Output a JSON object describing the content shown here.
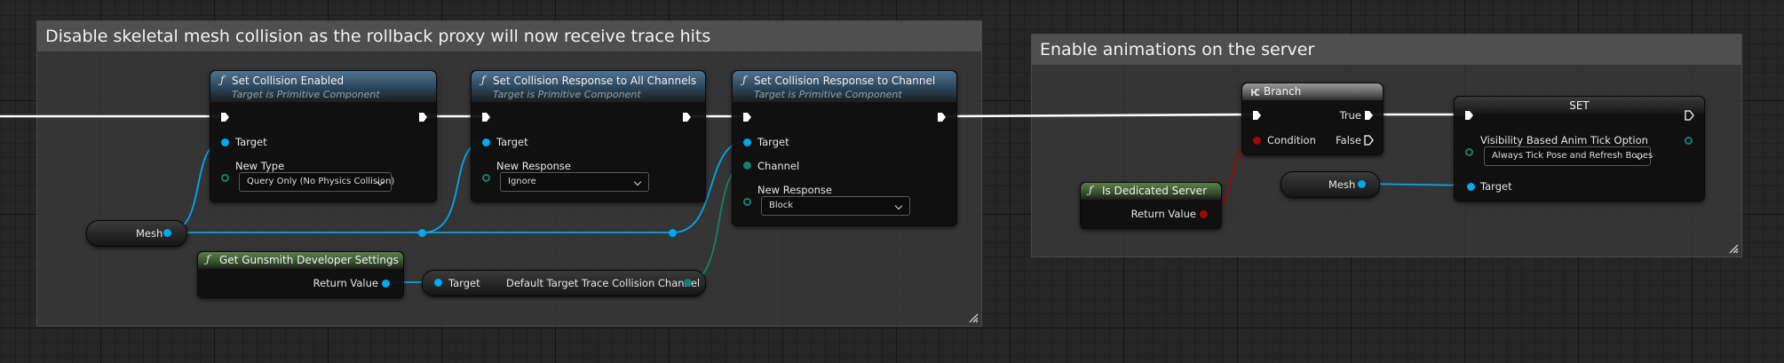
{
  "comments": [
    {
      "title": "Disable skeletal mesh collision as the rollback proxy will now receive trace hits"
    },
    {
      "title": "Enable animations on the server"
    }
  ],
  "nodes": {
    "set_collision_enabled": {
      "title": "Set Collision Enabled",
      "subtitle": "Target is Primitive Component",
      "target_label": "Target",
      "new_type_label": "New Type",
      "new_type_value": "Query Only (No Physics Collision)"
    },
    "set_response_all": {
      "title": "Set Collision Response to All Channels",
      "subtitle": "Target is Primitive Component",
      "target_label": "Target",
      "new_response_label": "New Response",
      "new_response_value": "Ignore"
    },
    "set_response_channel": {
      "title": "Set Collision Response to Channel",
      "subtitle": "Target is Primitive Component",
      "target_label": "Target",
      "channel_label": "Channel",
      "new_response_label": "New Response",
      "new_response_value": "Block"
    },
    "mesh_var_left": {
      "label": "Mesh"
    },
    "get_dev_settings": {
      "title": "Get Gunsmith Developer Settings",
      "return_label": "Return Value"
    },
    "default_channel": {
      "target_label": "Target",
      "output_label": "Default Target Trace Collision Channel"
    },
    "branch": {
      "title": "Branch",
      "true_label": "True",
      "false_label": "False",
      "condition_label": "Condition"
    },
    "is_dedicated_server": {
      "title": "Is Dedicated Server",
      "return_label": "Return Value"
    },
    "set_node": {
      "title": "SET",
      "property_label": "Visibility Based Anim Tick Option",
      "property_value": "Always Tick Pose and Refresh Bones",
      "target_label": "Target"
    },
    "mesh_var_right": {
      "label": "Mesh"
    }
  },
  "function_glyph": "ƒ",
  "colors": {
    "exec_wire": "#ffffff",
    "object_wire": "#00a8f0",
    "enum_wire": "#17806a",
    "bool_wire": "#a00808"
  }
}
